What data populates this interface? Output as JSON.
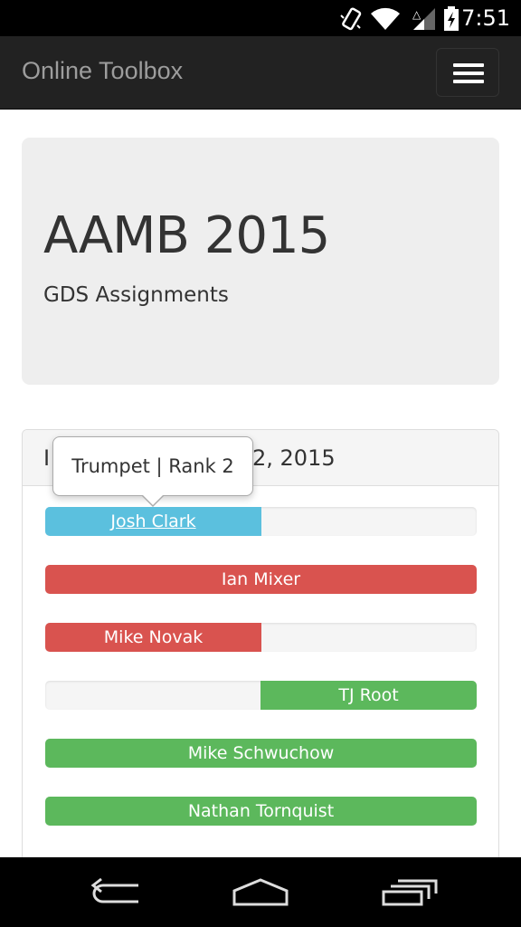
{
  "status_bar": {
    "time": "7:51"
  },
  "navbar": {
    "brand": "Online Toolbox",
    "toggle_icon": "hamburger-menu-icon"
  },
  "jumbotron": {
    "title": "AAMB 2015",
    "subtitle": "GDS Assignments"
  },
  "panel": {
    "title_left": "I",
    "title_right": "2, 2015",
    "players": [
      {
        "name": "Josh Clark",
        "color": "#5bc0de",
        "fill": 0.5,
        "align": "left",
        "link": true
      },
      {
        "name": "Ian Mixer",
        "color": "#d9534f",
        "fill": 1.0,
        "align": "left",
        "link": false
      },
      {
        "name": "Mike Novak",
        "color": "#d9534f",
        "fill": 0.5,
        "align": "left",
        "link": false
      },
      {
        "name": "TJ Root",
        "color": "#5cb85c",
        "fill": 0.5,
        "align": "right",
        "link": false
      },
      {
        "name": "Mike Schwuchow",
        "color": "#5cb85c",
        "fill": 1.0,
        "align": "left",
        "link": false
      },
      {
        "name": "Nathan Tornquist",
        "color": "#5cb85c",
        "fill": 1.0,
        "align": "left",
        "link": false
      }
    ]
  },
  "tooltip": {
    "text": "Trumpet | Rank 2"
  },
  "colors": {
    "info": "#5bc0de",
    "danger": "#d9534f",
    "success": "#5cb85c",
    "navbar": "#222222"
  }
}
